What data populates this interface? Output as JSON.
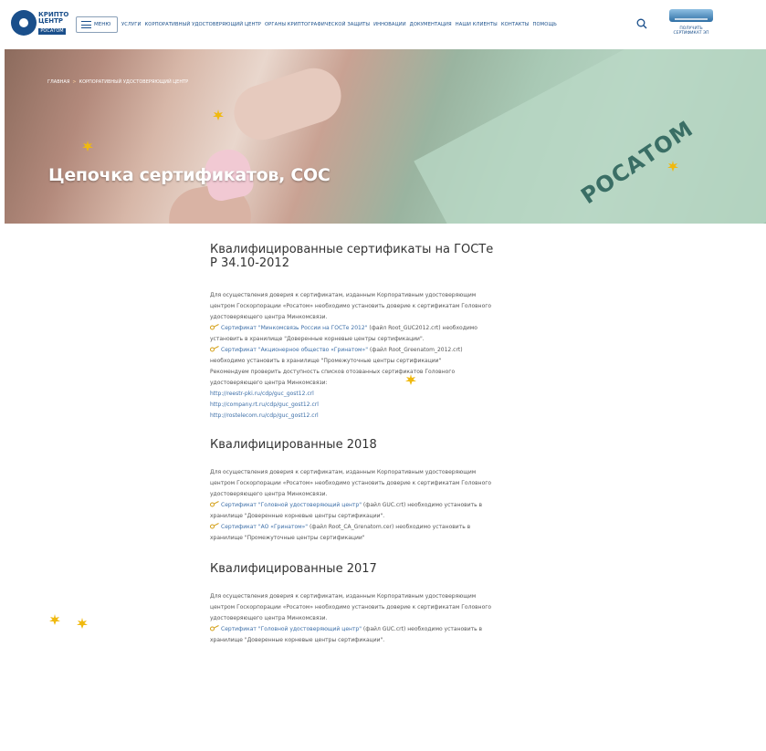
{
  "header": {
    "logo_line1": "КРИПТО ЦЕНТР",
    "logo_line2": "РОСАТОМ",
    "menu_label": "МЕНЮ",
    "nav": [
      "УСЛУГИ",
      "КОРПОРАТИВНЫЙ УДОСТОВЕРЯЮЩИЙ ЦЕНТР",
      "ОРГАНЫ КРИПТОГРАФИЧЕСКОЙ ЗАЩИТЫ",
      "ИННОВАЦИИ",
      "ДОКУМЕНТАЦИЯ",
      "НАШИ КЛИЕНТЫ",
      "КОНТАКТЫ",
      "ПОМОЩЬ"
    ],
    "cert_badge_top": "ПОЛУЧИТЬ",
    "cert_badge_bottom": "СЕРТИФИКАТ ЭП",
    "accent": "#1a4f8b"
  },
  "banner": {
    "breadcrumb": [
      "ГЛАВНАЯ",
      "КОРПОРАТИВНЫЙ УДОСТОВЕРЯЮЩИЙ ЦЕНТР"
    ],
    "breadcrumb_sep": ">",
    "title": "Цепочка сертификатов, СОС",
    "rosatom_text": "РОСАТОМ"
  },
  "sections": [
    {
      "title_line1": "Квалифицированные сертификаты на ГОСТе",
      "title_line2": "Р 34.10-2012",
      "intro": [
        "Для осуществления доверия к сертификатам, изданным Корпоративным удостоверяющим",
        "центром Госкорпорации «Росатом» необходимо установить доверие к сертификатам Головного",
        "удостоверяющего центра Минкомсвязи."
      ],
      "certs": [
        {
          "link": "Сертификат \"Минкомсвязь России на ГОСТе 2012\"",
          "rest1": " (файл Root_GUC2012.crt) необходимо",
          "rest2": "установить в хранилище \"Доверенные корневые центры сертификации\"."
        },
        {
          "link": "Сертификат \"Акционерное общество «Гринатом»\"",
          "rest1": " (файл Root_Greenatom_2012.crt)",
          "rest2": "необходимо установить в хранилище \"Промежуточные центры сертификации\""
        }
      ],
      "outro": [
        "Рекомендуем проверить доступность списков отозванных сертификатов Головного",
        "удостоверяющего центра Минкомсвязи:"
      ],
      "links": [
        "http://reestr-pki.ru/cdp/guc_gost12.crl",
        "http://company.rt.ru/cdp/guc_gost12.crl",
        "http://rostelecom.ru/cdp/guc_gost12.crl"
      ]
    },
    {
      "title_line1": "Квалифицированные 2018",
      "intro": [
        "Для осуществления доверия к сертификатам, изданным Корпоративным удостоверяющим",
        "центром Госкорпорации «Росатом» необходимо установить доверие к сертификатам Головного",
        "удостоверяющего центра Минкомсвязи."
      ],
      "certs": [
        {
          "link": "Сертификат \"Головной удостоверяющий центр\"",
          "rest1": " (файл GUC.crt) необходимо установить в",
          "rest2": "хранилище \"Доверенные корневые центры сертификации\"."
        },
        {
          "link": "Сертификат \"АО «Гринатом»\"",
          "rest1": " (файл Root_CA_Grenatom.cer) необходимо установить в",
          "rest2": "хранилище \"Промежуточные центры сертификации\""
        }
      ]
    },
    {
      "title_line1": "Квалифицированные 2017",
      "intro": [
        "Для осуществления доверия к сертификатам, изданным Корпоративным удостоверяющим",
        "центром Госкорпорации «Росатом» необходимо установить доверие к сертификатам Головного",
        "удостоверяющего центра Минкомсвязи."
      ],
      "certs": [
        {
          "link": "Сертификат \"Головной удостоверяющий центр\"",
          "rest1": " (файл GUC.crt) необходимо установить в",
          "rest2": "хранилище \"Доверенные корневые центры сертификации\"."
        }
      ]
    }
  ],
  "icons": {
    "search": "search-icon",
    "key": "key-icon",
    "leaf": "maple-leaf-icon"
  }
}
